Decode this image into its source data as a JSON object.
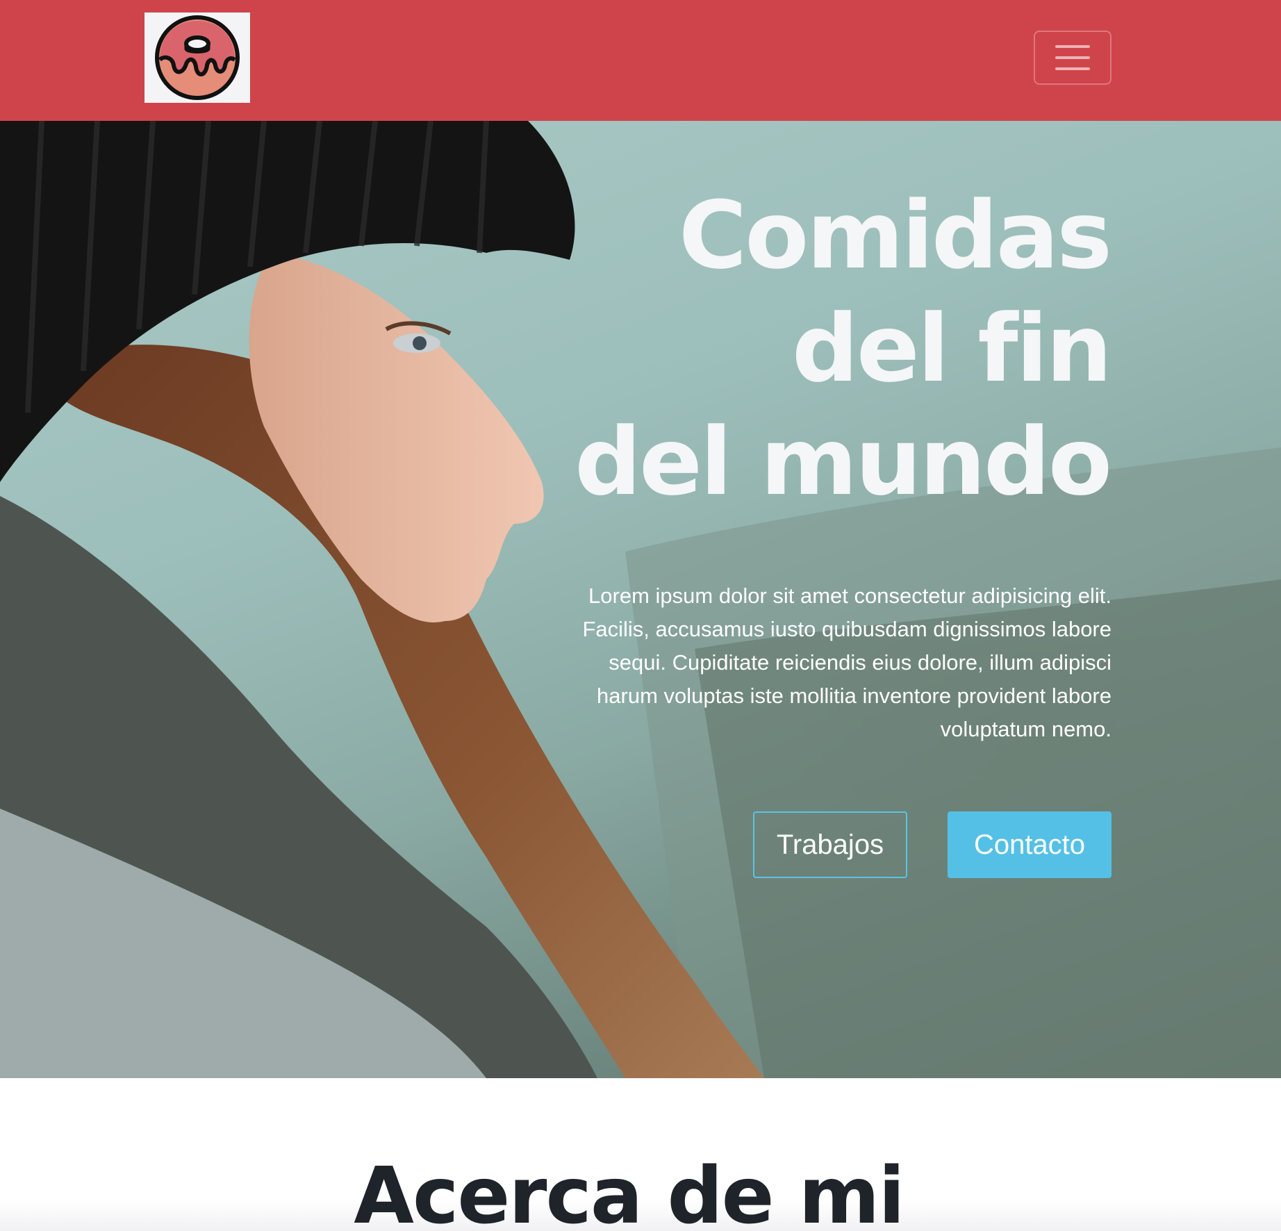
{
  "navbar": {
    "logo_icon": "donut-icon",
    "menu_icon": "hamburger-menu-icon",
    "background_color": "#cf444b"
  },
  "hero": {
    "title_line1": "Comidas",
    "title_line2": "del fin",
    "title_line3": "del mundo",
    "text": "Lorem ipsum dolor sit amet consectetur adipisicing elit. Facilis, accusamus iusto quibusdam dignissimos labore sequi. Cupiditate reiciendis eius dolore, illum adipisci harum voluptas iste mollitia inventore provident labore voluptatum nemo.",
    "buttons": {
      "works_label": "Trabajos",
      "contact_label": "Contacto"
    },
    "accent_color": "#55c0e6"
  },
  "about": {
    "title": "Acerca de mi"
  }
}
